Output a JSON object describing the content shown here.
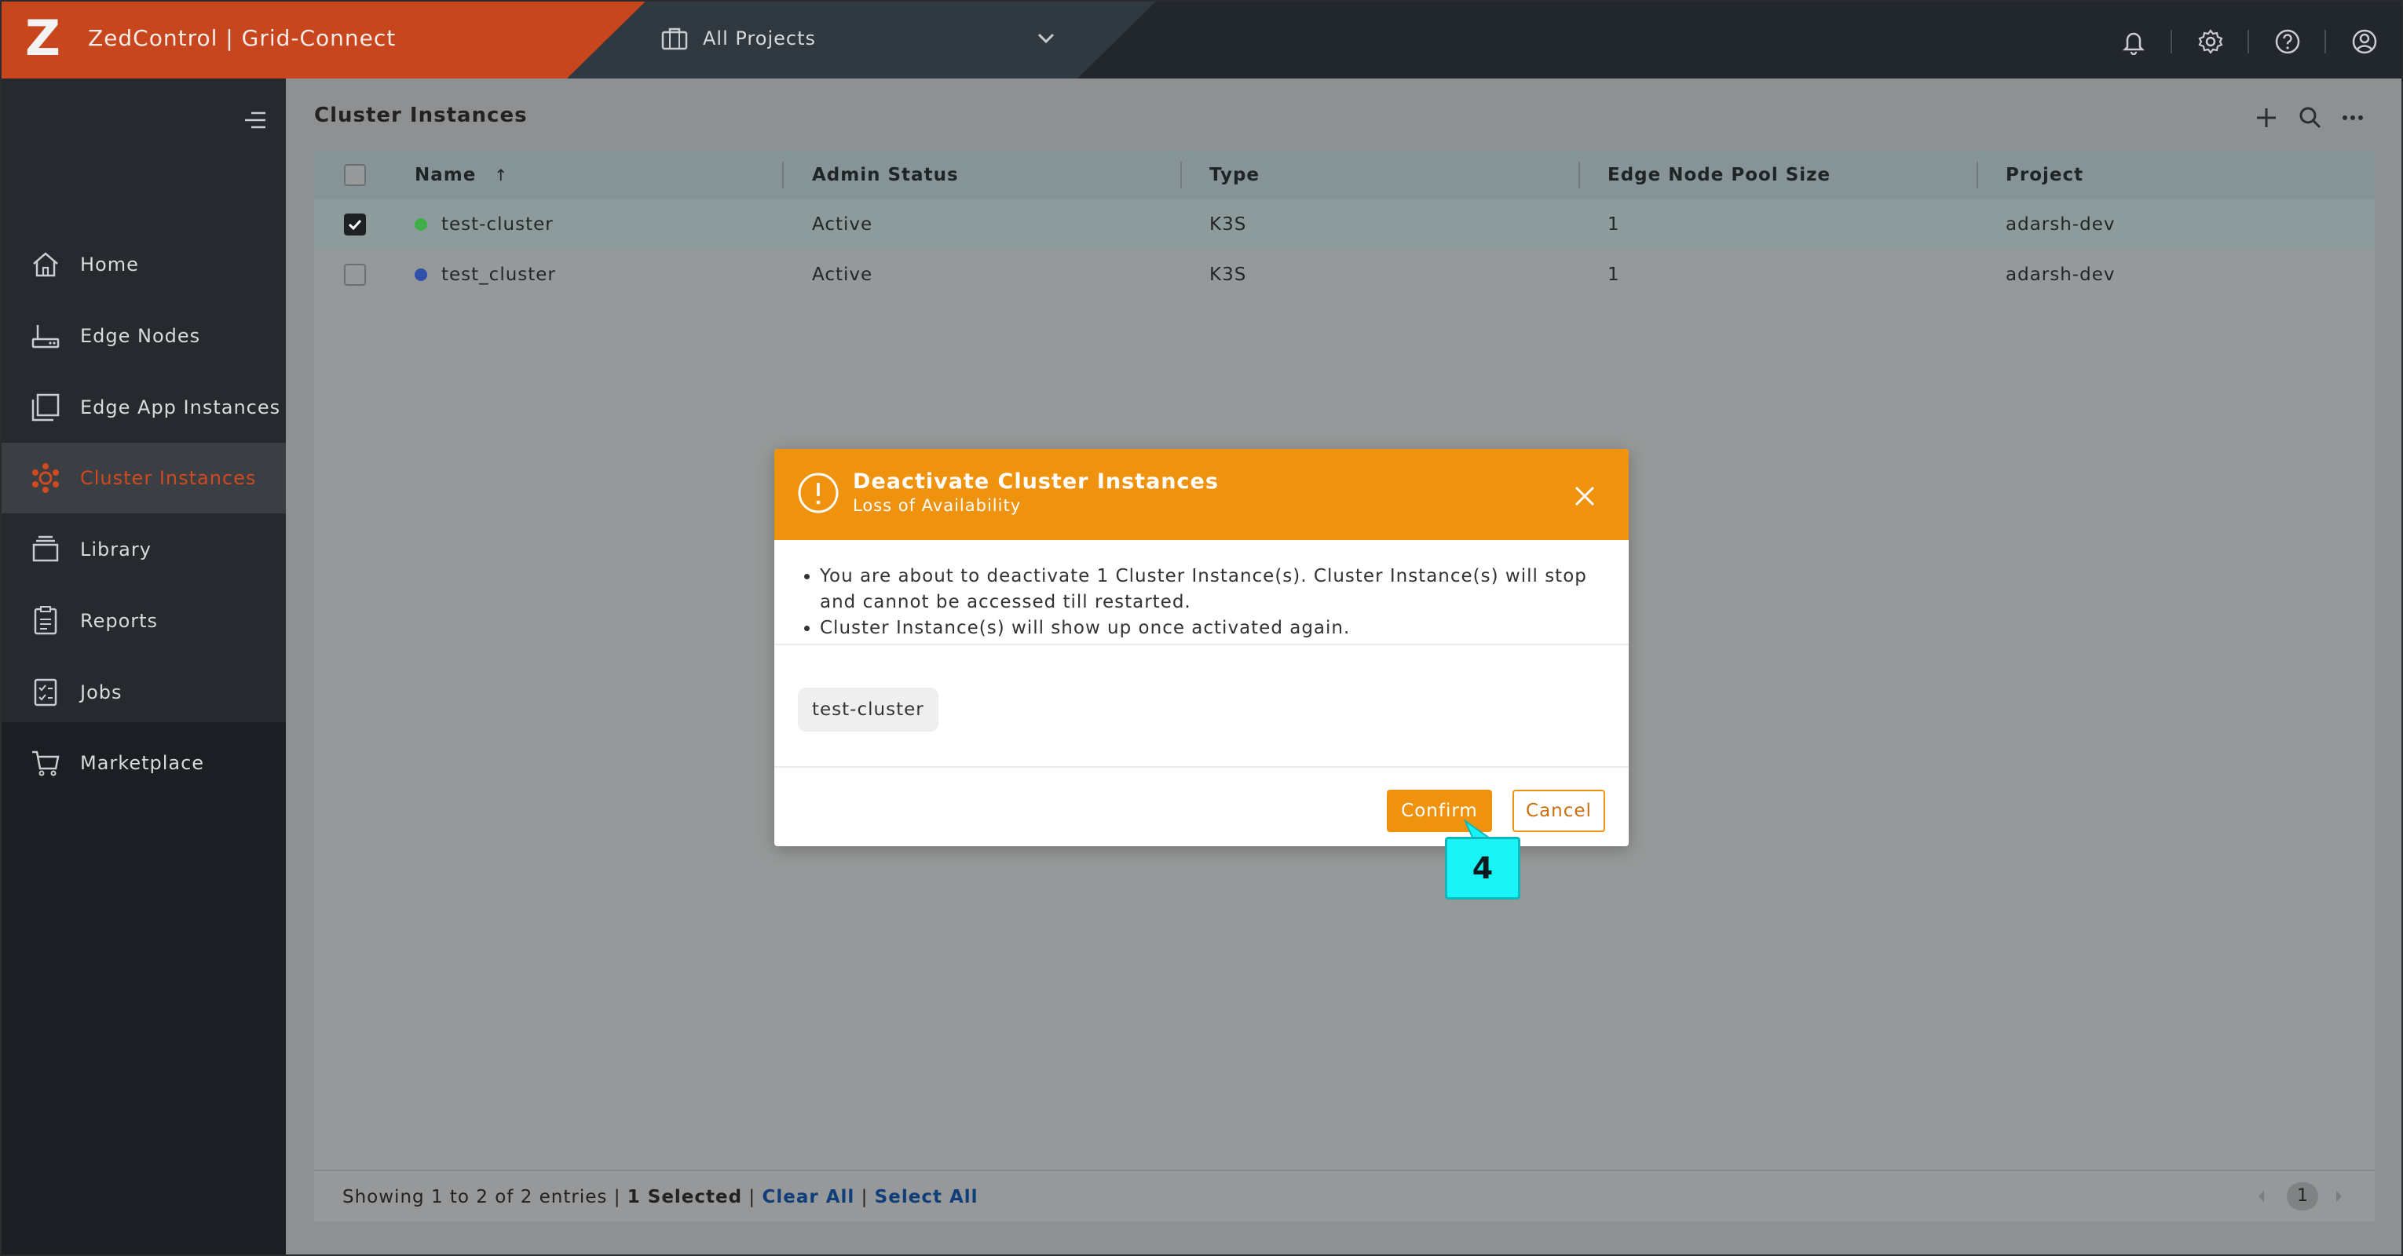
{
  "topbar": {
    "app_title": "ZedControl | Grid-Connect",
    "logo_letter": "Z",
    "project_selector": "All Projects",
    "icons": [
      "bell-icon",
      "gear-icon",
      "help-icon",
      "user-icon"
    ]
  },
  "sidebar": {
    "items": [
      {
        "label": "Home",
        "icon": "home-icon"
      },
      {
        "label": "Edge Nodes",
        "icon": "edge-node-icon"
      },
      {
        "label": "Edge App Instances",
        "icon": "app-instances-icon"
      },
      {
        "label": "Cluster Instances",
        "icon": "cluster-icon",
        "active": true
      },
      {
        "label": "Library",
        "icon": "library-icon"
      },
      {
        "label": "Reports",
        "icon": "reports-icon"
      },
      {
        "label": "Jobs",
        "icon": "jobs-icon"
      },
      {
        "label": "Marketplace",
        "icon": "cart-icon"
      }
    ]
  },
  "main": {
    "title": "Cluster Instances",
    "table": {
      "columns": [
        "Name",
        "Admin Status",
        "Type",
        "Edge Node Pool Size",
        "Project"
      ],
      "sort_indicator": "↑",
      "rows": [
        {
          "name": "test-cluster",
          "status": "Active",
          "type": "K3S",
          "pool_size": "1",
          "project": "adarsh-dev",
          "dot_color": "#3fae49",
          "selected": true
        },
        {
          "name": "test_cluster",
          "status": "Active",
          "type": "K3S",
          "pool_size": "1",
          "project": "adarsh-dev",
          "dot_color": "#2f4fa8",
          "selected": false
        }
      ]
    },
    "footer": {
      "showing": "Showing 1 to 2 of 2 entries |",
      "selected": "1 Selected",
      "sep1": "|",
      "clear_all": "Clear All",
      "sep2": "|",
      "select_all": "Select All",
      "page": "1"
    }
  },
  "dialog": {
    "title": "Deactivate Cluster Instances",
    "subtitle": "Loss of Availability",
    "bullets": [
      "You are about to deactivate 1 Cluster Instance(s). Cluster Instance(s) will stop and cannot be accessed till restarted.",
      "Cluster Instance(s) will show up once activated again."
    ],
    "chip": "test-cluster",
    "confirm_label": "Confirm",
    "cancel_label": "Cancel"
  },
  "callout": {
    "step": "4"
  },
  "colors": {
    "brand": "#c8461e",
    "dialog_accent": "#ef920e",
    "callout": "#18f4f6",
    "link": "#0f3e78"
  }
}
